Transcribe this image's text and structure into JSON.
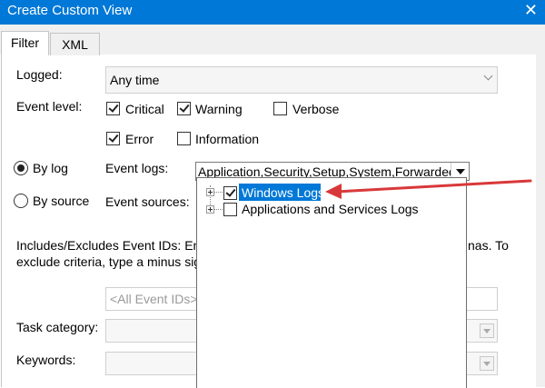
{
  "window": {
    "title": "Create Custom View",
    "close_glyph": "✕"
  },
  "tabs": [
    {
      "label": "Filter"
    },
    {
      "label": "XML"
    }
  ],
  "filter": {
    "logged_label": "Logged:",
    "logged_value": "Any time",
    "event_level_label": "Event level:",
    "levels": {
      "critical": {
        "label": "Critical",
        "checked": true
      },
      "warning": {
        "label": "Warning",
        "checked": true
      },
      "verbose": {
        "label": "Verbose",
        "checked": false
      },
      "error": {
        "label": "Error",
        "checked": true
      },
      "information": {
        "label": "Information",
        "checked": false
      }
    },
    "by_log_label": "By log",
    "by_source_label": "By source",
    "event_logs_label": "Event logs:",
    "event_logs_value": "Application,Security,Setup,System,Forwarded Ev",
    "event_sources_label": "Event sources:",
    "event_ids_text_line1": "Includes/Excludes Event IDs: Ente",
    "event_ids_text_line2": "exclude criteria, type a minus sig",
    "event_ids_text_tail1": "nas. To",
    "event_ids_placeholder": "<All Event IDs>",
    "task_category_label": "Task category:",
    "keywords_label": "Keywords:"
  },
  "tree": [
    {
      "label": "Windows Logs",
      "checked": true,
      "selected": true
    },
    {
      "label": "Applications and Services Logs",
      "checked": false,
      "selected": false
    }
  ],
  "colors": {
    "accent": "#0078d7",
    "arrow": "#d9383a"
  }
}
